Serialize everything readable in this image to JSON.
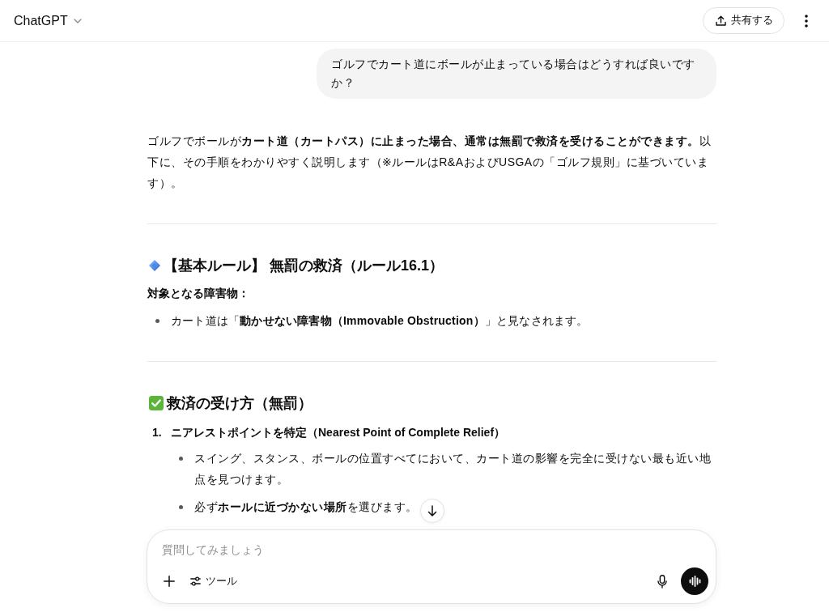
{
  "header": {
    "title": "ChatGPT",
    "share_button": "共有する"
  },
  "user_message": {
    "text": "ゴルフでカート道にボールが止まっている場合はどうすれば良いですか？"
  },
  "response": [
    {
      "kind": "paragraph",
      "text": "ゴルフでボールが**カート道（カートパス）に止まった場合、通常は無罰で救済を受けることができます。**以下に、その手順をわかりやすく説明します（※ルールはR&AおよびUSGAの「ゴルフ規則」に基づいています）。"
    },
    {
      "kind": "divider"
    },
    {
      "kind": "heading",
      "text": "【基本ルール】 無罰の救済（ルール16.1）"
    },
    {
      "kind": "label",
      "text": "対象となる障害物："
    },
    {
      "kind": "bullets",
      "items": [
        {
          "text": "カート道は「**動かせない障害物（Immovable Obstruction）**」と見なされます。"
        }
      ]
    },
    {
      "kind": "divider"
    },
    {
      "kind": "heading",
      "text": "救済の受け方（無罰）"
    },
    {
      "kind": "numbered",
      "items": [
        {
          "number": "1.",
          "text": "ニアレストポイントを特定（Nearest Point of Complete Relief）",
          "children": [
            {
              "text": "スイング、スタンス、ボールの位置すべてにおいて、カート道の影響を完全に受けない最も近い地点を見つけます。"
            },
            {
              "text": "必ず**ホールに近づかない場所**を選びます。"
            }
          ]
        }
      ]
    }
  ],
  "composer": {
    "placeholder": "質問してみましょう",
    "tools_button": "ツール"
  }
}
